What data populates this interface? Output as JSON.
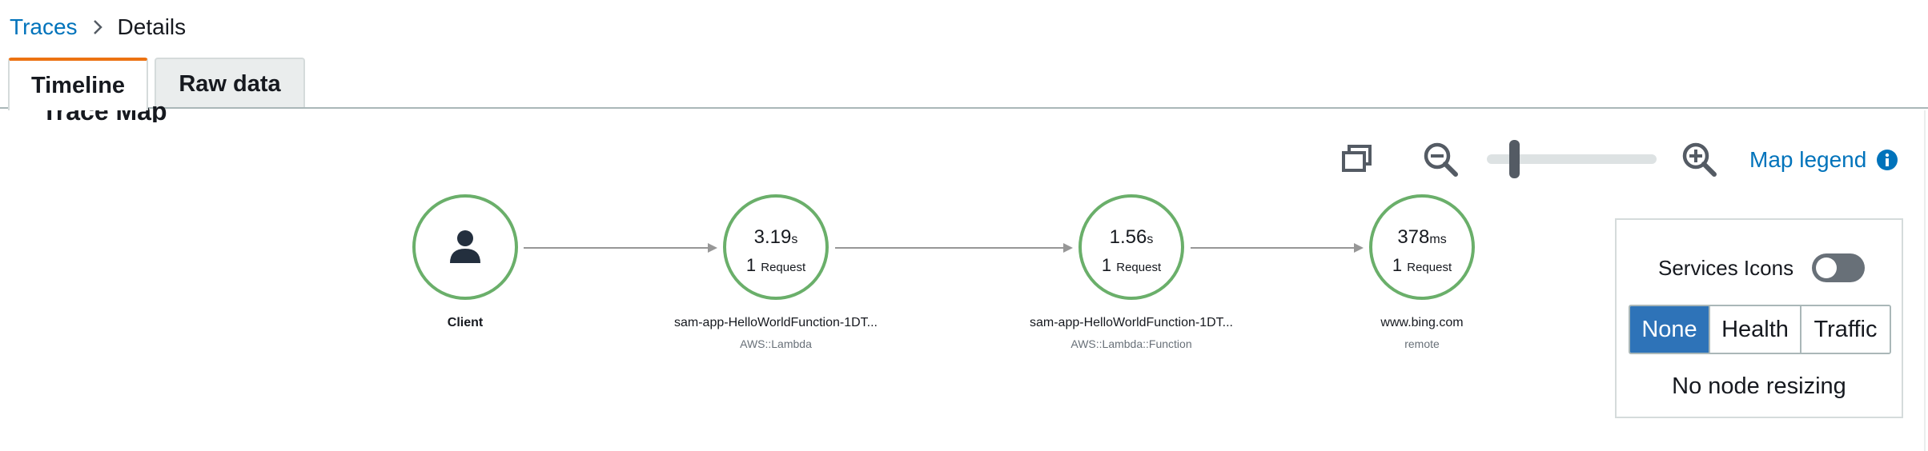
{
  "breadcrumb": {
    "parent": "Traces",
    "current": "Details"
  },
  "tabs": [
    {
      "label": "Timeline",
      "active": true
    },
    {
      "label": "Raw data",
      "active": false
    }
  ],
  "trace_map": {
    "title": "Trace Map",
    "toolbar": {
      "icons": [
        "fit-view-icon",
        "zoom-out-icon",
        "zoom-in-icon",
        "info-icon"
      ],
      "zoom_level": 0.15,
      "legend_label": "Map legend"
    },
    "nodes": [
      {
        "name": "Client",
        "type": "",
        "icon": "user-icon"
      },
      {
        "name": "sam-app-HelloWorldFunction-1DT...",
        "type": "AWS::Lambda",
        "time_value": "3.19",
        "time_unit": "s",
        "requests": "1",
        "request_label": "Request"
      },
      {
        "name": "sam-app-HelloWorldFunction-1DT...",
        "type": "AWS::Lambda::Function",
        "time_value": "1.56",
        "time_unit": "s",
        "requests": "1",
        "request_label": "Request"
      },
      {
        "name": "www.bing.com",
        "type": "remote",
        "time_value": "378",
        "time_unit": "ms",
        "requests": "1",
        "request_label": "Request"
      }
    ],
    "colors": {
      "node_border": "#6aaf6a",
      "edge": "#979797",
      "link": "#0073bb",
      "active_tab_accent": "#ec7211",
      "segment_active": "#2e73b8"
    }
  },
  "settings": {
    "services_icons_label": "Services Icons",
    "services_icons_on": false,
    "segments": [
      "None",
      "Health",
      "Traffic"
    ],
    "selected_segment": "None",
    "resize_note": "No node resizing"
  }
}
